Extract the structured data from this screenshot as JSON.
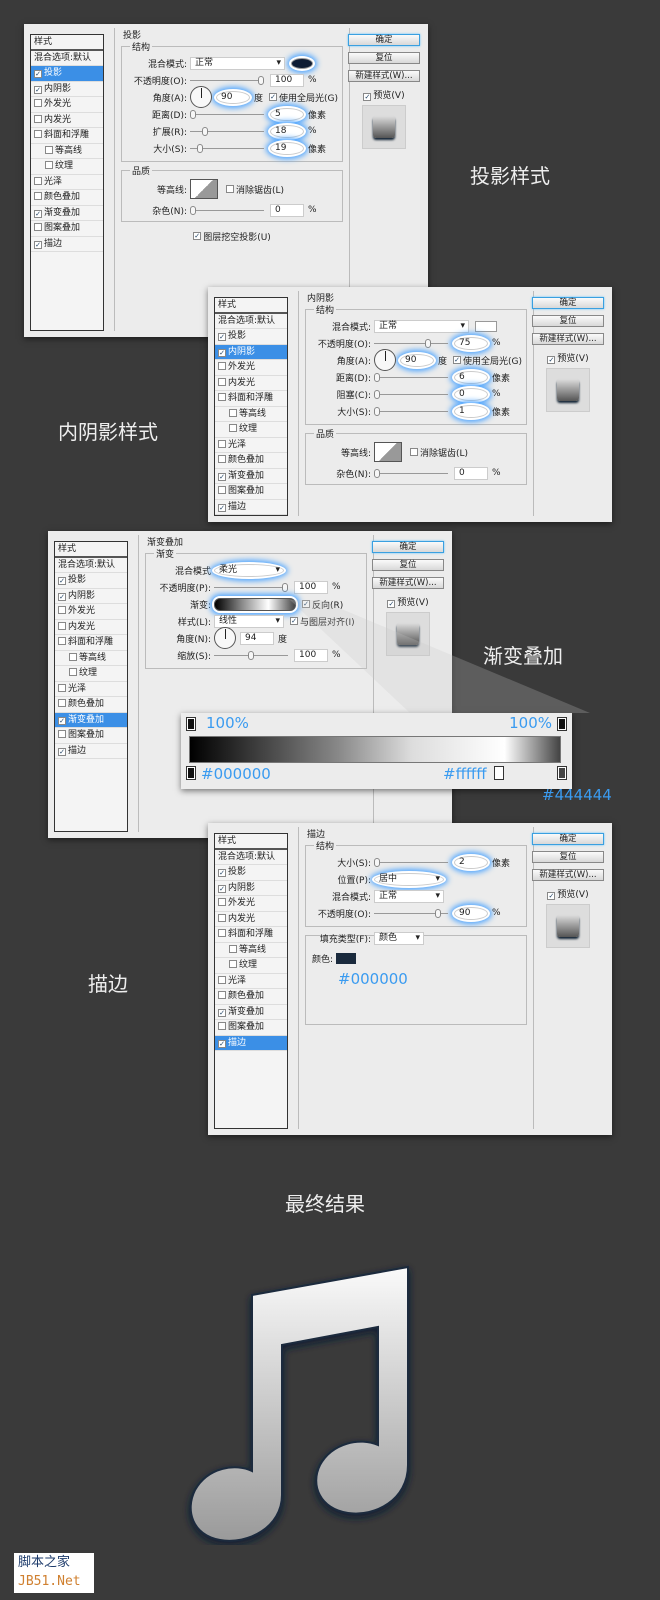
{
  "sidebar_header": "样式",
  "sidebar_items": [
    "混合选项:默认",
    "投影",
    "内阴影",
    "外发光",
    "内发光",
    "斜面和浮雕",
    "等高线",
    "纹理",
    "光泽",
    "颜色叠加",
    "渐变叠加",
    "图案叠加",
    "描边"
  ],
  "sidebar_checked": [
    false,
    true,
    true,
    false,
    false,
    false,
    false,
    false,
    false,
    false,
    true,
    false,
    true
  ],
  "buttons": {
    "ok": "确定",
    "reset": "复位",
    "new_style": "新建样式(W)...",
    "preview": "预览(V)"
  },
  "dialogs": [
    {
      "active": 1,
      "title": "投影",
      "group1": "结构",
      "group2": "品质",
      "rows": [
        {
          "type": "dd",
          "label": "混合模式:",
          "value": "正常",
          "swatch": "#0d1b33",
          "glow_swatch": true
        },
        {
          "type": "slider",
          "label": "不透明度(O):",
          "value": "100",
          "unit": "%",
          "pos": 1.0
        },
        {
          "type": "dial",
          "label": "角度(A):",
          "value": "90",
          "unit": "度",
          "check": "使用全局光(G)",
          "glow": true
        },
        {
          "type": "slider",
          "label": "距离(D):",
          "value": "5",
          "unit": "像素",
          "pos": 0.0,
          "glow": true
        },
        {
          "type": "slider",
          "label": "扩展(R):",
          "value": "18",
          "unit": "%",
          "pos": 0.18,
          "glow": true
        },
        {
          "type": "slider",
          "label": "大小(S):",
          "value": "19",
          "unit": "像素",
          "pos": 0.1,
          "glow": true
        }
      ],
      "contour": "等高线:",
      "antialias": "消除锯齿(L)",
      "noise": {
        "label": "杂色(N):",
        "value": "0",
        "unit": "%"
      },
      "extra_check": "图层挖空投影(U)"
    },
    {
      "active": 2,
      "title": "内阴影",
      "group1": "结构",
      "group2": "品质",
      "rows": [
        {
          "type": "dd",
          "label": "混合模式:",
          "value": "正常",
          "swatch": "#ffffff"
        },
        {
          "type": "slider",
          "label": "不透明度(O):",
          "value": "75",
          "unit": "%",
          "pos": 0.75,
          "glow": true
        },
        {
          "type": "dial",
          "label": "角度(A):",
          "value": "90",
          "unit": "度",
          "check": "使用全局光(G)",
          "glow": true
        },
        {
          "type": "slider",
          "label": "距离(D):",
          "value": "6",
          "unit": "像素",
          "pos": 0.0,
          "glow": true
        },
        {
          "type": "slider",
          "label": "阻塞(C):",
          "value": "0",
          "unit": "%",
          "pos": 0.0,
          "glow": true
        },
        {
          "type": "slider",
          "label": "大小(S):",
          "value": "1",
          "unit": "像素",
          "pos": 0.0,
          "glow": true
        }
      ],
      "contour": "等高线:",
      "antialias": "消除锯齿(L)",
      "noise": {
        "label": "杂色(N):",
        "value": "0",
        "unit": "%"
      }
    },
    {
      "active": 10,
      "title": "渐变叠加",
      "group1": "渐变",
      "rows": [
        {
          "type": "dd",
          "label": "混合模式",
          "value": "柔光",
          "glow": true
        },
        {
          "type": "slider",
          "label": "不透明度(P):",
          "value": "100",
          "unit": "%",
          "pos": 1.0
        },
        {
          "type": "grad",
          "label": "渐变:",
          "check": "反向(R)",
          "glow": true
        },
        {
          "type": "dd",
          "label": "样式(L):",
          "value": "线性",
          "check": "与图层对齐(I)"
        },
        {
          "type": "dial",
          "label": "角度(N):",
          "value": "94",
          "unit": "度"
        },
        {
          "type": "slider",
          "label": "缩放(S):",
          "value": "100",
          "unit": "%",
          "pos": 0.5
        }
      ]
    },
    {
      "active": 12,
      "title": "描边",
      "group1": "结构",
      "rows": [
        {
          "type": "slider",
          "label": "大小(S):",
          "value": "2",
          "unit": "像素",
          "pos": 0.0,
          "glow": true
        },
        {
          "type": "dd",
          "label": "位置(P):",
          "value": "居中",
          "glow": true
        },
        {
          "type": "dd",
          "label": "混合模式:",
          "value": "正常"
        },
        {
          "type": "slider",
          "label": "不透明度(O):",
          "value": "90",
          "unit": "%",
          "pos": 0.9,
          "glow": true
        }
      ],
      "fill_type": {
        "label": "填充类型(F):",
        "value": "颜色"
      },
      "color_label": "颜色:",
      "color": "#1a2a3d",
      "color_hex": "#000000"
    }
  ],
  "gradient_callout": {
    "left_opacity": "100%",
    "right_opacity": "100%",
    "left_color": "#000000",
    "mid_color": "#ffffff",
    "right_color": "#444444"
  },
  "captions": {
    "drop_shadow": "投影样式",
    "inner_shadow": "内阴影样式",
    "gradient": "渐变叠加",
    "stroke": "描边",
    "final": "最终结果"
  },
  "watermark": {
    "line1": "脚本之家",
    "line2": "JB51.Net"
  }
}
